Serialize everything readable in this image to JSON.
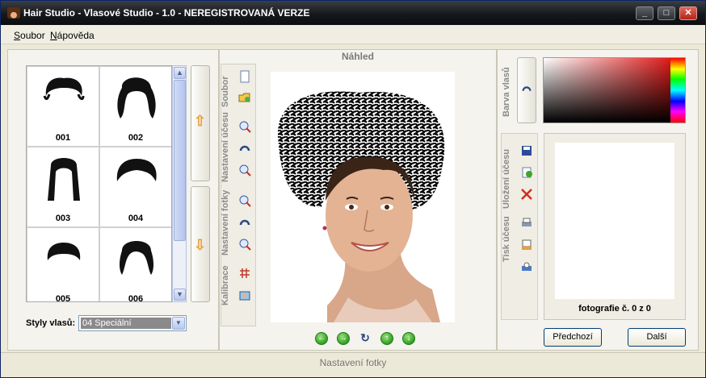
{
  "window": {
    "title": "Hair Studio - Vlasové Studio - 1.0 - NEREGISTROVANÁ VERZE",
    "controls": {
      "minimize": "_",
      "maximize": "□",
      "close": "✕"
    }
  },
  "menu": {
    "items": [
      {
        "label": "Soubor",
        "mnemonic": "S",
        "rest": "oubor"
      },
      {
        "label": "Nápověda",
        "mnemonic": "N",
        "rest": "ápověda"
      }
    ]
  },
  "left_panel": {
    "hairstyles": [
      {
        "label": "001"
      },
      {
        "label": "002"
      },
      {
        "label": "003"
      },
      {
        "label": "004"
      },
      {
        "label": "005"
      },
      {
        "label": "006"
      }
    ],
    "styles_label": "Styly vlasů:",
    "styles_value": "04 Speciální",
    "up_arrow": "⇧",
    "down_arrow": "⇩"
  },
  "middle_panel": {
    "header": "Náhled",
    "tabs": [
      {
        "label": "Soubor"
      },
      {
        "label": "Nastavení účesu"
      },
      {
        "label": "Nastavení fotky"
      },
      {
        "label": "Kalibrace"
      }
    ],
    "nav_buttons": [
      {
        "symbol": "←"
      },
      {
        "symbol": "→"
      },
      {
        "symbol": "↻"
      },
      {
        "symbol": "↑"
      },
      {
        "symbol": "↓"
      }
    ]
  },
  "right_panel": {
    "color_tab": "Barva vlasů",
    "save_tab": "Uložení účesu",
    "print_tab": "Tisk účesu",
    "photo_count": "fotografie č. 0 z 0",
    "prev_button": "Předchozí",
    "next_button": "Další"
  },
  "status": {
    "text": "Nastavení fotky"
  },
  "colors": {
    "accent": "#e8a03a",
    "nav_green": "#2f9f22",
    "scrollbar": "#b6c7ee",
    "tab_text": "#8a8a8a"
  }
}
